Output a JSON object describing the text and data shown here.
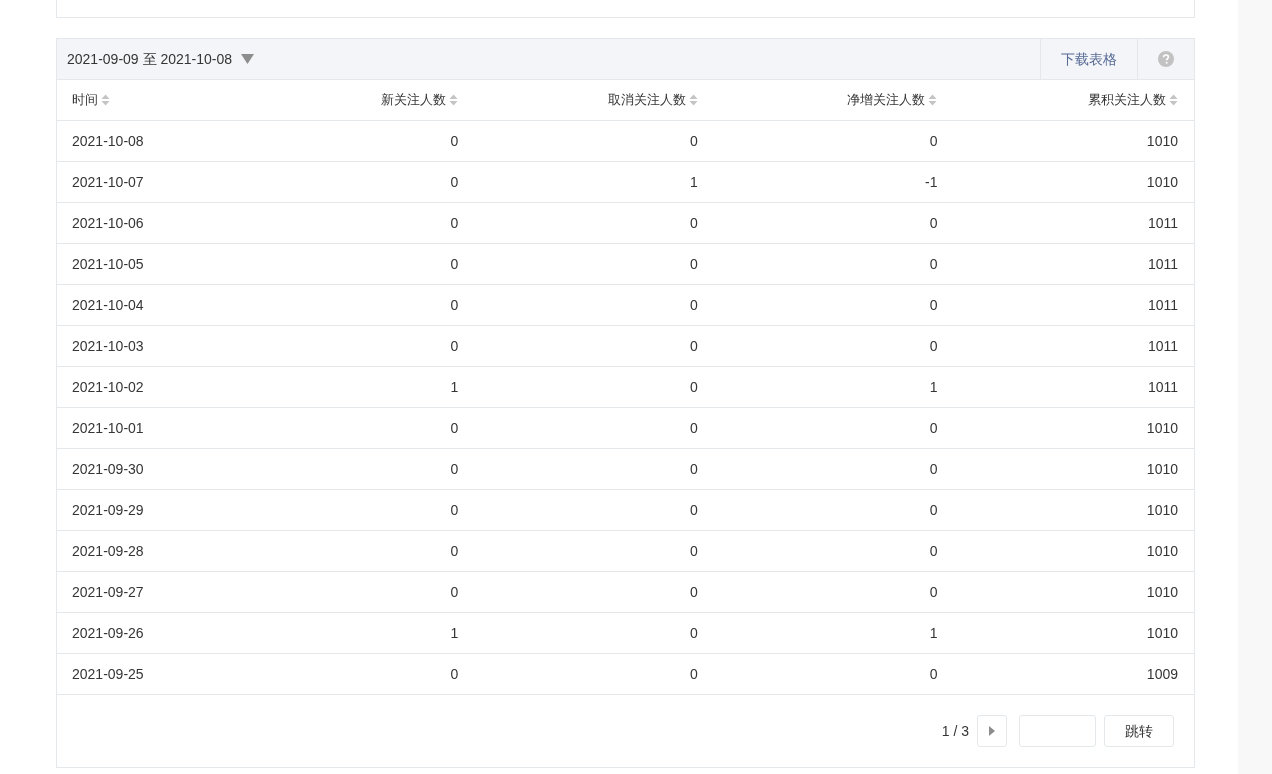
{
  "date_range": {
    "label": "2021-09-09 至 2021-10-08"
  },
  "toolbar": {
    "download": "下载表格"
  },
  "table": {
    "columns": [
      "时间",
      "新关注人数",
      "取消关注人数",
      "净增关注人数",
      "累积关注人数"
    ],
    "rows": [
      [
        "2021-10-08",
        "0",
        "0",
        "0",
        "1010"
      ],
      [
        "2021-10-07",
        "0",
        "1",
        "-1",
        "1010"
      ],
      [
        "2021-10-06",
        "0",
        "0",
        "0",
        "1011"
      ],
      [
        "2021-10-05",
        "0",
        "0",
        "0",
        "1011"
      ],
      [
        "2021-10-04",
        "0",
        "0",
        "0",
        "1011"
      ],
      [
        "2021-10-03",
        "0",
        "0",
        "0",
        "1011"
      ],
      [
        "2021-10-02",
        "1",
        "0",
        "1",
        "1011"
      ],
      [
        "2021-10-01",
        "0",
        "0",
        "0",
        "1010"
      ],
      [
        "2021-09-30",
        "0",
        "0",
        "0",
        "1010"
      ],
      [
        "2021-09-29",
        "0",
        "0",
        "0",
        "1010"
      ],
      [
        "2021-09-28",
        "0",
        "0",
        "0",
        "1010"
      ],
      [
        "2021-09-27",
        "0",
        "0",
        "0",
        "1010"
      ],
      [
        "2021-09-26",
        "1",
        "0",
        "1",
        "1010"
      ],
      [
        "2021-09-25",
        "0",
        "0",
        "0",
        "1009"
      ]
    ]
  },
  "pagination": {
    "page": "1 / 3",
    "jump": "跳转"
  }
}
